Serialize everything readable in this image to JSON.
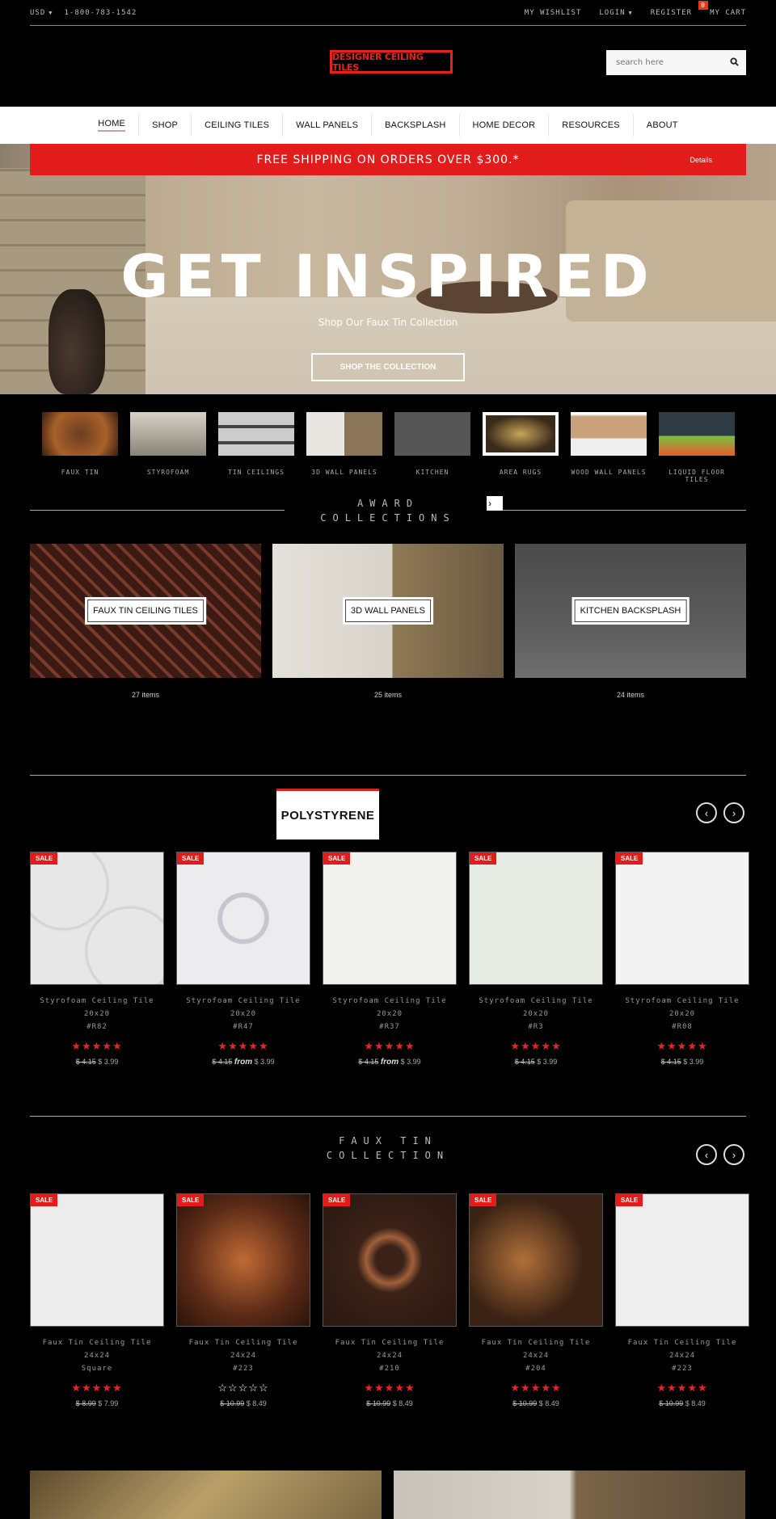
{
  "topbar": {
    "currency": "USD",
    "phone": "1-800-783-1542",
    "wishlist": "MY WISHLIST",
    "login": "LOGIN",
    "register": "REGISTER",
    "cart": "MY CART",
    "cart_count": "0"
  },
  "header": {
    "logo_text": "DESIGNER CEILING TILES",
    "search_placeholder": "search here"
  },
  "nav": {
    "items": [
      "HOME",
      "SHOP",
      "CEILING TILES",
      "WALL PANELS",
      "BACKSPLASH",
      "HOME DECOR",
      "RESOURCES",
      "ABOUT"
    ],
    "active": "HOME"
  },
  "banner": {
    "text": "FREE SHIPPING ON ORDERS OVER $300.*",
    "details": "Details",
    "color": "#e21b1b"
  },
  "hero": {
    "title": "GET INSPIRED",
    "subtitle": "Shop Our Faux Tin Collection",
    "button": "SHOP THE COLLECTION"
  },
  "categories": [
    {
      "label": "FAUX TIN"
    },
    {
      "label": "STYROFOAM"
    },
    {
      "label": "TIN CEILINGS"
    },
    {
      "label": "3D WALL PANELS"
    },
    {
      "label": "KITCHEN"
    },
    {
      "label": "AREA RUGS"
    },
    {
      "label": "WOOD WALL PANELS"
    },
    {
      "label": "LIQUID FLOOR TILES"
    }
  ],
  "featured": {
    "title_line1": "AWARD",
    "title_line2": "COLLECTIONS",
    "panels": [
      {
        "label": "FAUX TIN CEILING TILES",
        "count": "27 items"
      },
      {
        "label": "3D WALL PANELS",
        "count": "25 items"
      },
      {
        "label": "KITCHEN BACKSPLASH",
        "count": "24 items"
      }
    ]
  },
  "section1": {
    "title": "POLYSTYRENE",
    "products": [
      {
        "badge": "SALE",
        "name1": "Styrofoam Ceiling Tile 20x20",
        "name2": "#R82",
        "rating": 5,
        "old_price": "$ 4.15",
        "from": "",
        "price": "$ 3.99"
      },
      {
        "badge": "SALE",
        "name1": "Styrofoam Ceiling Tile 20x20",
        "name2": "#R47",
        "rating": 5,
        "old_price": "$ 4.15",
        "from": "from",
        "price": "$ 3.99"
      },
      {
        "badge": "SALE",
        "name1": "Styrofoam Ceiling Tile 20x20",
        "name2": "#R37",
        "rating": 5,
        "old_price": "$ 4.15",
        "from": "from",
        "price": "$ 3.99"
      },
      {
        "badge": "SALE",
        "name1": "Styrofoam Ceiling Tile 20x20",
        "name2": "#R3",
        "rating": 5,
        "old_price": "$ 4.15",
        "from": "",
        "price": "$ 3.99"
      },
      {
        "badge": "SALE",
        "name1": "Styrofoam Ceiling Tile 20x20",
        "name2": "#R08",
        "rating": 5,
        "old_price": "$ 4.15",
        "from": "",
        "price": "$ 3.99"
      }
    ]
  },
  "section2": {
    "title_line1": "FAUX TIN",
    "title_line2": "COLLECTION",
    "products": [
      {
        "badge": "SALE",
        "name1": "Faux Tin Ceiling Tile 24x24",
        "name2": "Square",
        "rating": 5,
        "old_price": "$ 8.99",
        "price": "$ 7.99"
      },
      {
        "badge": "SALE",
        "name1": "Faux Tin Ceiling Tile 24x24",
        "name2": "#223",
        "rating": 0,
        "old_price": "$ 10.99",
        "price": "$ 8.49"
      },
      {
        "badge": "SALE",
        "name1": "Faux Tin Ceiling Tile 24x24",
        "name2": "#210",
        "rating": 5,
        "old_price": "$ 10.99",
        "price": "$ 8.49"
      },
      {
        "badge": "SALE",
        "name1": "Faux Tin Ceiling Tile 24x24",
        "name2": "#204",
        "rating": 5,
        "old_price": "$ 10.99",
        "price": "$ 8.49"
      },
      {
        "badge": "SALE",
        "name1": "Faux Tin Ceiling Tile 24x24",
        "name2": "#223",
        "rating": 5,
        "old_price": "$ 10.99",
        "price": "$ 8.49"
      }
    ]
  },
  "icons": {
    "search": "search-icon",
    "prev": "chevron-left-icon",
    "next": "chevron-right-icon",
    "star_filled": "★",
    "star_empty": "☆"
  }
}
